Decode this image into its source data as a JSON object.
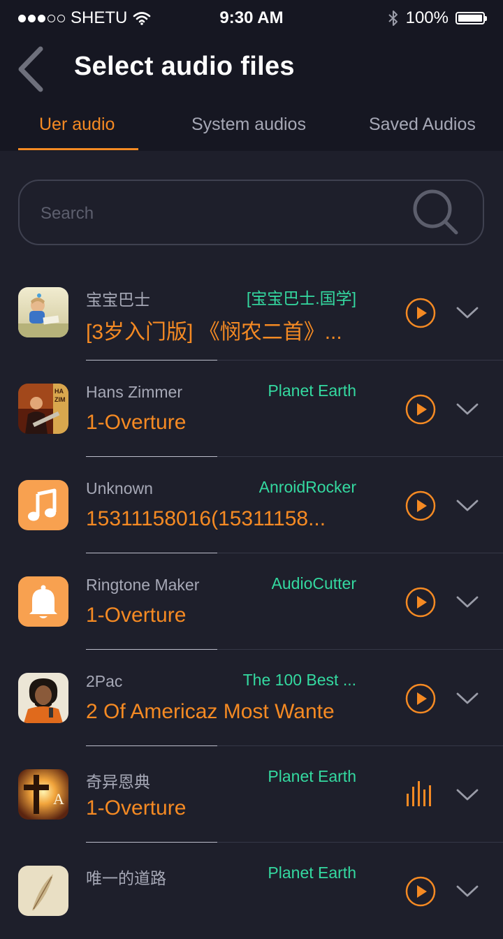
{
  "status_bar": {
    "carrier": "SHETU",
    "time": "9:30 AM",
    "battery": "100%",
    "battery_level": 1.0,
    "signal_icon": "signal-dots-icon",
    "wifi_icon": "wifi-icon",
    "bluetooth_icon": "bluetooth-icon"
  },
  "header": {
    "title": "Select audio files",
    "back_icon": "chevron-left-icon"
  },
  "tabs": [
    {
      "label": "Uer audio",
      "active": true
    },
    {
      "label": "System audios",
      "active": false
    },
    {
      "label": "Saved Audios",
      "active": false
    }
  ],
  "search": {
    "placeholder": "Search",
    "icon": "search-icon"
  },
  "colors": {
    "accent": "#f58a23",
    "album_text": "#34d9a0",
    "background": "#1e1f2b",
    "header_bg": "#161722"
  },
  "tracks": [
    {
      "artist": "宝宝巴士",
      "album": "[宝宝巴士.国学]",
      "title": "[3岁入门版] 《悯农二首》...",
      "thumb": "child-reading-art",
      "state": "play"
    },
    {
      "artist": "Hans Zimmer",
      "album": "Planet Earth",
      "title": "1-Overture",
      "thumb": "hans-zimmer-live-art",
      "state": "play"
    },
    {
      "artist": "Unknown",
      "album": "AnroidRocker",
      "title": "15311158016(15311158...",
      "thumb": "music-note-icon",
      "state": "play"
    },
    {
      "artist": "Ringtone Maker",
      "album": "AudioCutter",
      "title": "1-Overture",
      "thumb": "bell-icon",
      "state": "play"
    },
    {
      "artist": "2Pac",
      "album": "The 100 Best ...",
      "title": "2 Of Americaz Most Wante",
      "thumb": "portrait-art",
      "state": "play"
    },
    {
      "artist": "奇异恩典",
      "album": "Planet Earth",
      "title": "1-Overture",
      "thumb": "cross-sunset-art",
      "state": "playing"
    },
    {
      "artist": "唯一的道路",
      "album": "Planet Earth",
      "title": "",
      "thumb": "feather-art",
      "state": "play"
    }
  ]
}
